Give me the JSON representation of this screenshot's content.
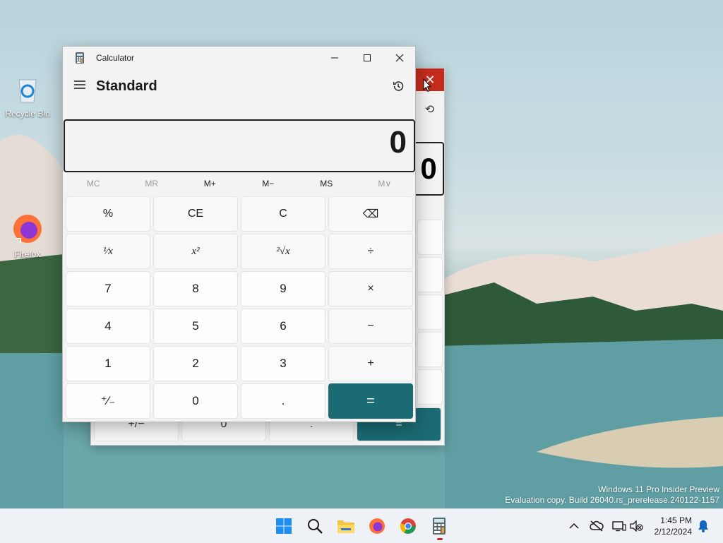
{
  "desktop": {
    "icons": [
      {
        "label": "Recycle Bin",
        "icon": "recycle-bin-icon"
      },
      {
        "label": "Firefox",
        "icon": "firefox-icon"
      }
    ],
    "watermark": {
      "line1": "Windows 11 Pro Insider Preview",
      "line2": "Evaluation copy. Build 26040.rs_prerelease.240122-1157"
    }
  },
  "background_window": {
    "display_value": "0",
    "bottom_row": [
      "+/−",
      "0",
      ".",
      "="
    ]
  },
  "calculator": {
    "title": "Calculator",
    "mode": "Standard",
    "display_value": "0",
    "memory": [
      {
        "label": "MC",
        "enabled": false
      },
      {
        "label": "MR",
        "enabled": false
      },
      {
        "label": "M+",
        "enabled": true
      },
      {
        "label": "M−",
        "enabled": true
      },
      {
        "label": "MS",
        "enabled": true
      },
      {
        "label": "M∨",
        "enabled": false
      }
    ],
    "keys": [
      {
        "label": "%",
        "name": "percent-key"
      },
      {
        "label": "CE",
        "name": "clear-entry-key"
      },
      {
        "label": "C",
        "name": "clear-key"
      },
      {
        "label": "⌫",
        "name": "backspace-key"
      },
      {
        "label": "¹⁄x",
        "name": "reciprocal-key"
      },
      {
        "label": "x²",
        "name": "square-key"
      },
      {
        "label": "²√x",
        "name": "square-root-key"
      },
      {
        "label": "÷",
        "name": "divide-key"
      },
      {
        "label": "7",
        "name": "digit-7-key"
      },
      {
        "label": "8",
        "name": "digit-8-key"
      },
      {
        "label": "9",
        "name": "digit-9-key"
      },
      {
        "label": "×",
        "name": "multiply-key"
      },
      {
        "label": "4",
        "name": "digit-4-key"
      },
      {
        "label": "5",
        "name": "digit-5-key"
      },
      {
        "label": "6",
        "name": "digit-6-key"
      },
      {
        "label": "−",
        "name": "subtract-key"
      },
      {
        "label": "1",
        "name": "digit-1-key"
      },
      {
        "label": "2",
        "name": "digit-2-key"
      },
      {
        "label": "3",
        "name": "digit-3-key"
      },
      {
        "label": "+",
        "name": "add-key"
      },
      {
        "label": "⁺⁄₋",
        "name": "negate-key"
      },
      {
        "label": "0",
        "name": "digit-0-key"
      },
      {
        "label": ".",
        "name": "decimal-key"
      },
      {
        "label": "=",
        "name": "equals-key"
      }
    ],
    "accent_color": "#1b6b74"
  },
  "taskbar": {
    "apps": [
      "start-icon",
      "search-icon",
      "file-explorer-icon",
      "firefox-icon",
      "chrome-icon",
      "calculator-icon"
    ],
    "clock_time": "1:45 PM",
    "clock_date": "2/12/2024"
  }
}
